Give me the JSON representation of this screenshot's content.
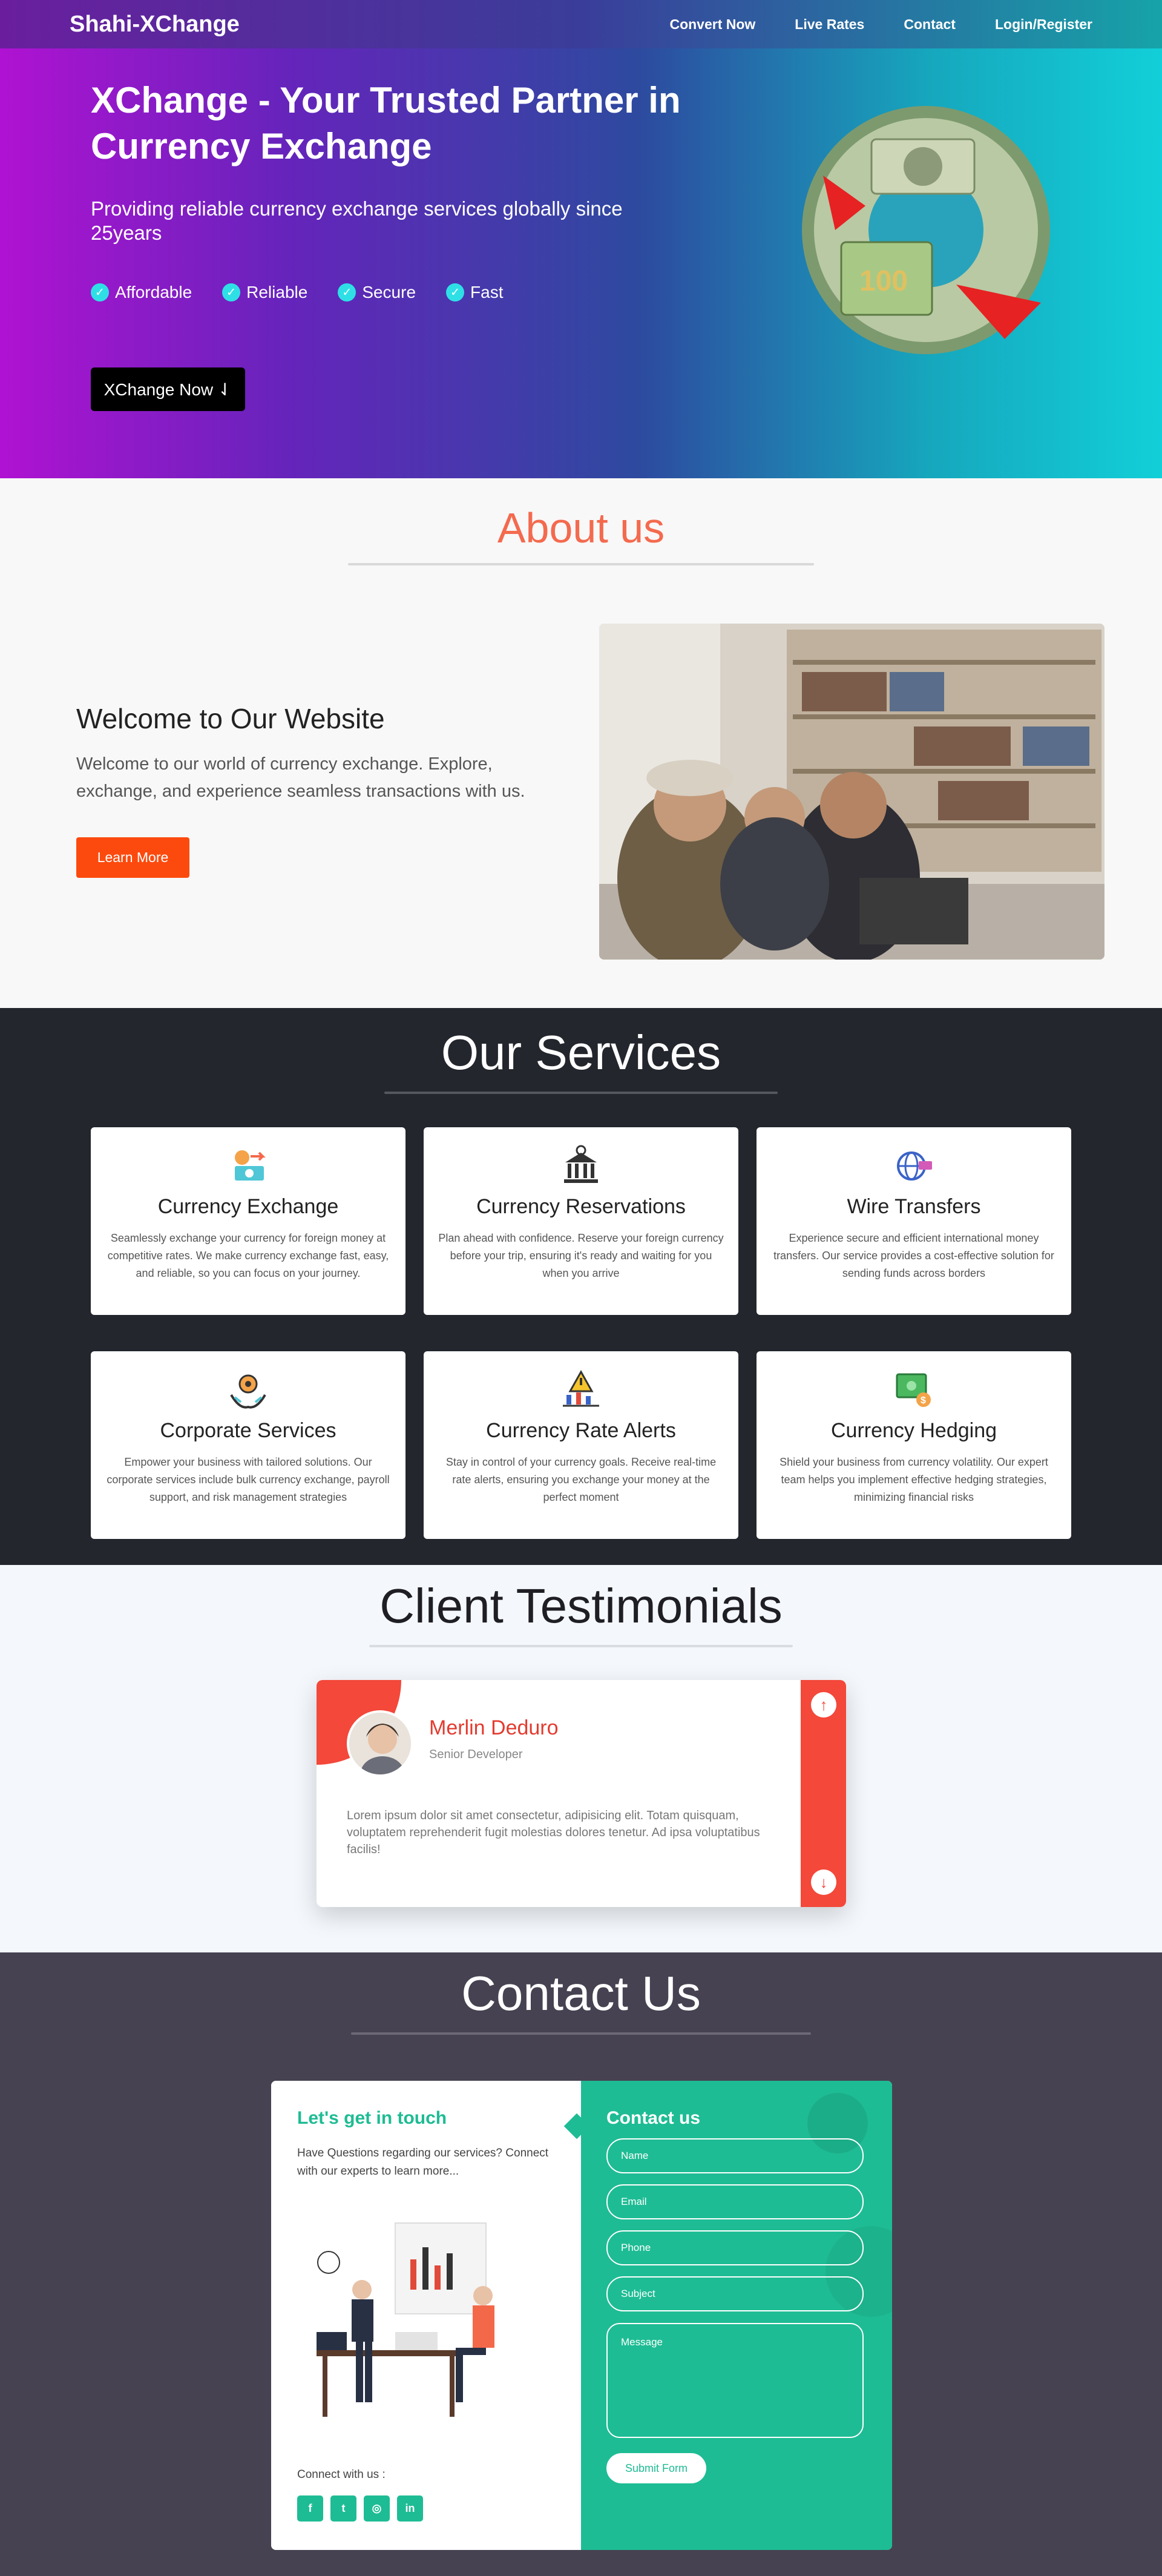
{
  "nav": {
    "brand": "Shahi-XChange",
    "links": [
      "Convert Now",
      "Live Rates",
      "Contact",
      "Login/Register"
    ]
  },
  "hero": {
    "title": "XChange - Your Trusted Partner in Currency Exchange",
    "subtitle": "Providing reliable currency exchange services globally since 25years",
    "features": [
      "Affordable",
      "Reliable",
      "Secure",
      "Fast"
    ],
    "cta": "XChange Now ⇃",
    "check_icon": "check-circle-icon"
  },
  "about": {
    "title": "About us",
    "heading": "Welcome to Our Website",
    "text": "Welcome to our world of currency exchange. Explore, exchange, and experience seamless transactions with us.",
    "button": "Learn More"
  },
  "services": {
    "title": "Our Services",
    "items": [
      {
        "icon": "currency-exchange-icon",
        "title": "Currency Exchange",
        "text": "Seamlessly exchange your currency for foreign money at competitive rates. We make currency exchange fast, easy, and reliable, so you can focus on your journey."
      },
      {
        "icon": "bank-icon",
        "title": "Currency Reservations",
        "text": "Plan ahead with confidence. Reserve your foreign currency before your trip, ensuring it's ready and waiting for you when you arrive"
      },
      {
        "icon": "globe-transfer-icon",
        "title": "Wire Transfers",
        "text": "Experience secure and efficient international money transfers. Our service provides a cost-effective solution for sending funds across borders"
      },
      {
        "icon": "hand-gear-icon",
        "title": "Corporate Services",
        "text": "Empower your business with tailored solutions. Our corporate services include bulk currency exchange, payroll support, and risk management strategies"
      },
      {
        "icon": "alert-chart-icon",
        "title": "Currency Rate Alerts",
        "text": "Stay in control of your currency goals. Receive real-time rate alerts, ensuring you exchange your money at the perfect moment"
      },
      {
        "icon": "money-shield-icon",
        "title": "Currency Hedging",
        "text": "Shield your business from currency volatility. Our expert team helps you implement effective hedging strategies, minimizing financial risks"
      }
    ]
  },
  "testimonials": {
    "title": "Client Testimonials",
    "name": "Merlin Deduro",
    "role": "Senior Developer",
    "quote": "Lorem ipsum dolor sit amet consectetur, adipisicing elit. Totam quisquam, voluptatem reprehenderit fugit molestias dolores tenetur. Ad ipsa voluptatibus facilis!",
    "up_icon": "arrow-up-icon",
    "down_icon": "arrow-down-icon",
    "accent": "#f3483a"
  },
  "contact": {
    "title": "Contact Us",
    "left_title": "Let's get in touch",
    "left_text": "Have Questions regarding our services? Connect with our experts to learn more...",
    "connect_label": "Connect with us :",
    "socials": [
      "f",
      "t",
      "◎",
      "in"
    ],
    "social_icons": [
      "facebook-icon",
      "twitter-icon",
      "instagram-icon",
      "linkedin-icon"
    ],
    "form_title": "Contact us",
    "placeholders": {
      "name": "Name",
      "email": "Email",
      "phone": "Phone",
      "subject": "Subject",
      "message": "Message"
    },
    "submit": "Submit Form",
    "accent": "#1ebc94"
  }
}
